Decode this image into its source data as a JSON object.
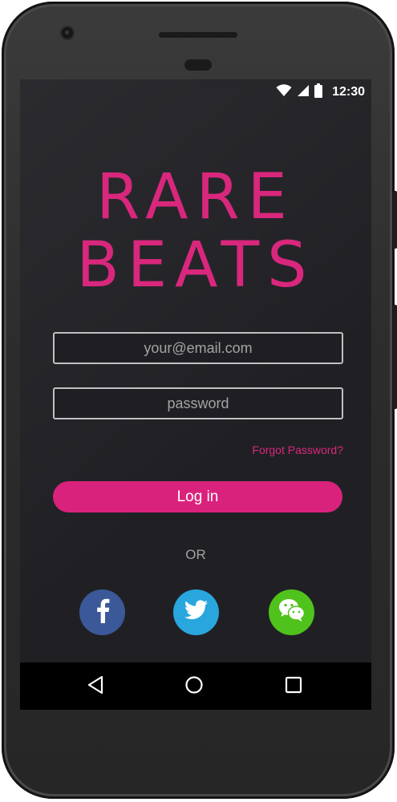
{
  "device": {
    "name": "Android phone",
    "frame_color": "#2f2f2f"
  },
  "status_bar": {
    "time": "12:30",
    "icons": [
      "wifi-icon",
      "cell-signal-icon",
      "battery-icon"
    ]
  },
  "brand": {
    "line1": "RARE",
    "line2": "BEATS",
    "color": "#d9277d"
  },
  "login_form": {
    "email_placeholder": "your@email.com",
    "email_value": "",
    "password_placeholder": "password",
    "password_value": "",
    "forgot_password_label": "Forgot Password?",
    "login_label": "Log in",
    "accent_color": "#d9227c"
  },
  "divider": {
    "or_label": "OR"
  },
  "social_login": [
    {
      "name": "facebook",
      "icon": "facebook-icon",
      "color": "#3b5998"
    },
    {
      "name": "twitter",
      "icon": "twitter-icon",
      "color": "#2aa6de"
    },
    {
      "name": "wechat",
      "icon": "wechat-icon",
      "color": "#50c21c"
    }
  ],
  "nav_bar": {
    "buttons": [
      "back-icon",
      "home-icon",
      "recents-icon"
    ]
  }
}
